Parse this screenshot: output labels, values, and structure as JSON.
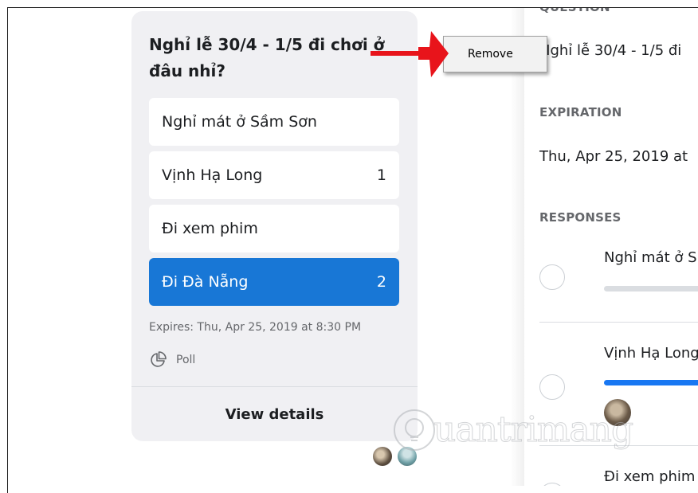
{
  "poll_card": {
    "title": "Nghỉ lễ 30/4 - 1/5 đi chơi ở đâu nhỉ?",
    "options": [
      {
        "label": "Nghỉ mát ở Sầm Sơn",
        "count": ""
      },
      {
        "label": "Vịnh Hạ Long",
        "count": "1"
      },
      {
        "label": "Đi xem phim",
        "count": ""
      },
      {
        "label": "Đi Đà Nẵng",
        "count": "2",
        "selected": true
      }
    ],
    "expires": "Expires: Thu, Apr 25, 2019 at 8:30 PM",
    "type_label": "Poll",
    "view_details": "View details"
  },
  "context_menu": {
    "remove_label": "Remove"
  },
  "details_panel": {
    "question_label": "QUESTION",
    "question_text": "Nghỉ lễ 30/4 - 1/5 đi",
    "expiration_label": "EXPIRATION",
    "expiration_text": "Thu, Apr 25, 2019 at",
    "responses_label": "RESPONSES",
    "responses": [
      {
        "label": "Nghỉ mát ở S",
        "bar_color": "#dadde1"
      },
      {
        "label": "Vịnh Hạ Long",
        "bar_color": "#1877f2"
      },
      {
        "label": "Đi xem phim"
      }
    ]
  },
  "watermark": "uantrimang",
  "colors": {
    "accent": "#1877d6",
    "arrow": "#e8141b"
  }
}
